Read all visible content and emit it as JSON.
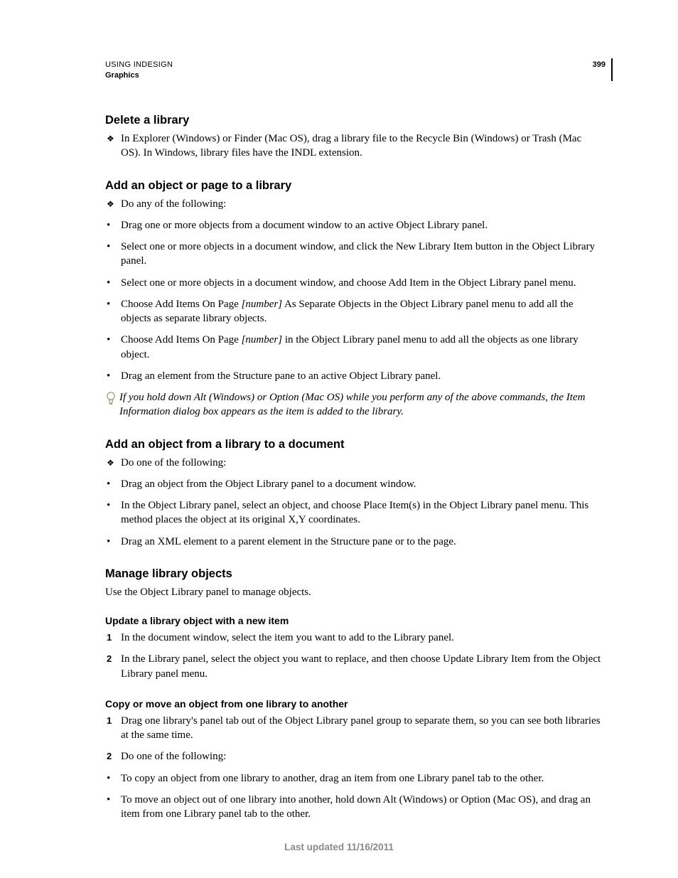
{
  "header": {
    "line1": "USING INDESIGN",
    "line2": "Graphics",
    "pageNumber": "399"
  },
  "sections": {
    "delete": {
      "title": "Delete a library",
      "items": [
        "In Explorer (Windows) or Finder (Mac OS), drag a library file to the Recycle Bin (Windows) or Trash (Mac OS). In Windows, library files have the INDL extension."
      ]
    },
    "addObjectPage": {
      "title": "Add an object or page to a library",
      "lead": "Do any of the following:",
      "bullets": [
        "Drag one or more objects from a document window to an active Object Library panel.",
        "Select one or more objects in a document window, and click the New Library Item button in the Object Library panel.",
        "Select one or more objects in a document window, and choose Add Item in the Object Library panel menu.",
        "",
        "",
        "Drag an element from the Structure pane to an active Object Library panel."
      ],
      "bullet4_pre": "Choose Add Items On Page ",
      "bullet4_num": "[number]",
      "bullet4_post": " As Separate Objects in the Object Library panel menu to add all the objects as separate library objects.",
      "bullet5_pre": "Choose Add Items On Page ",
      "bullet5_num": "[number]",
      "bullet5_post": " in the Object Library panel menu to add all the objects as one library object.",
      "tip": "If you hold down Alt (Windows) or Option (Mac OS) while you perform any of the above commands, the Item Information dialog box appears as the item is added to the library."
    },
    "addFromLibrary": {
      "title": "Add an object from a library to a document",
      "lead": "Do one of the following:",
      "bullets": [
        "Drag an object from the Object Library panel to a document window.",
        "In the Object Library panel, select an object, and choose Place Item(s) in the Object Library panel menu. This method places the object at its original X,Y coordinates.",
        "Drag an XML element to a parent element in the Structure pane or to the page."
      ]
    },
    "manage": {
      "title": "Manage library objects",
      "intro": "Use the Object Library panel to manage objects.",
      "sub1": {
        "title": "Update a library object with a new item",
        "steps": [
          "In the document window, select the item you want to add to the Library panel.",
          "In the Library panel, select the object you want to replace, and then choose Update Library Item from the Object Library panel menu."
        ]
      },
      "sub2": {
        "title": "Copy or move an object from one library to another",
        "steps": [
          "Drag one library's panel tab out of the Object Library panel group to separate them, so you can see both libraries at the same time.",
          "Do one of the following:"
        ],
        "bullets": [
          "To copy an object from one library to another, drag an item from one Library panel tab to the other.",
          "To move an object out of one library into another, hold down Alt (Windows) or Option (Mac OS), and drag an item from one Library panel tab to the other."
        ]
      }
    }
  },
  "footer": "Last updated 11/16/2011",
  "markers": {
    "diamond": "❖",
    "dot": "•",
    "n1": "1",
    "n2": "2"
  }
}
